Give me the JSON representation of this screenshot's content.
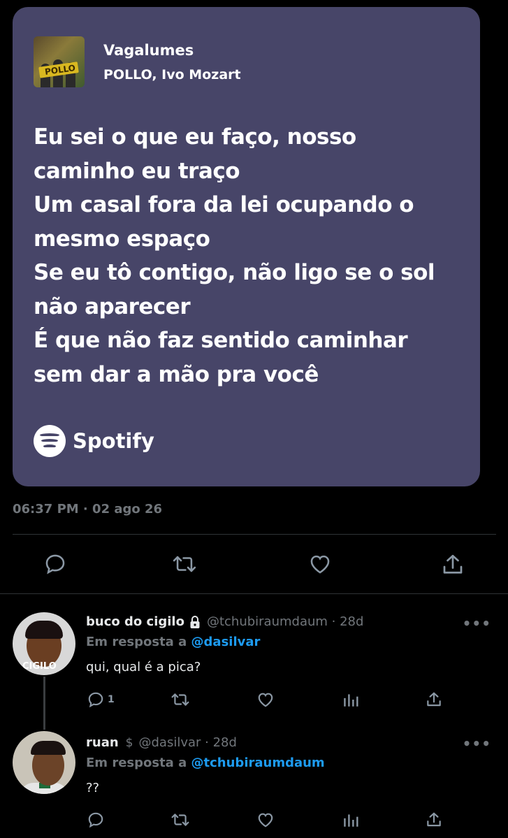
{
  "card": {
    "song_title": "Vagalumes",
    "artists": "POLLO, Ivo Mozart",
    "cover_text": "POLLO",
    "lyrics": [
      "Eu sei o que eu faço, nosso",
      "caminho eu traço",
      "Um casal fora da lei ocupando o",
      "mesmo espaço",
      "Se eu tô contigo, não ligo se o sol",
      "não aparecer",
      "É que não faz sentido caminhar",
      "sem dar a mão pra você"
    ],
    "brand": "Spotify",
    "background_color": "#474568"
  },
  "tweet": {
    "timestamp": "06:37 PM · 02 ago 26"
  },
  "replies": [
    {
      "name": "buco do cigilo",
      "handle": "@tchubiraumdaum · 28d",
      "reply_prefix": "Em resposta a",
      "reply_mention": "@dasilvar",
      "text": "qui, qual é a pica?",
      "avatar_label": "CIGILO",
      "reply_count": "1"
    },
    {
      "name": "ruan",
      "handle": "@dasilvar · 28d",
      "reply_prefix": "Em resposta a",
      "reply_mention": "@tchubiraumdaum",
      "text": "??"
    }
  ],
  "icons": {
    "reply": "reply-icon",
    "retweet": "retweet-icon",
    "like": "heart-icon",
    "views": "views-icon",
    "share": "share-icon",
    "more": "more-icon",
    "lock": "lock-icon"
  },
  "colors": {
    "mention": "#1d9bf0",
    "muted": "#71767b",
    "text": "#e7e9ea"
  }
}
